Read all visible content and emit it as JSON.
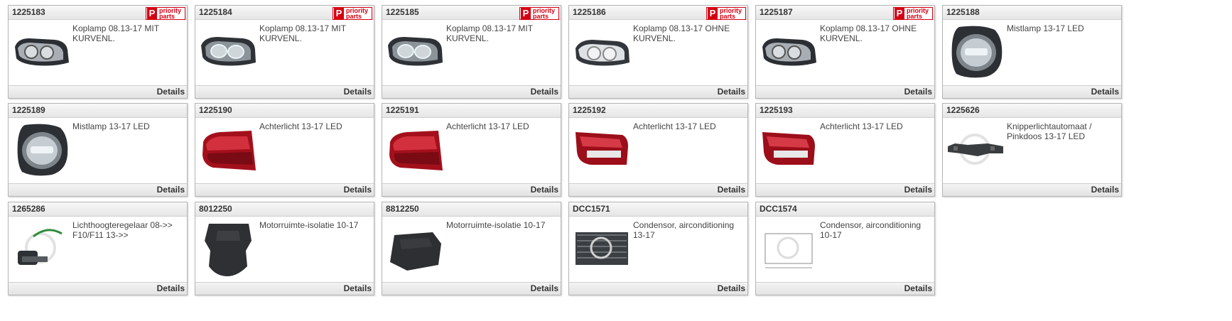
{
  "badge": {
    "letter": "P",
    "line1": "priority",
    "line2": "parts"
  },
  "products": [
    {
      "code": "1225183",
      "desc": "Koplamp 08.13-17 MIT KURVENL.",
      "details": "Details",
      "icon": "headlamp-dark",
      "priority": true
    },
    {
      "code": "1225184",
      "desc": "Koplamp 08.13-17 MIT KURVENL.",
      "details": "Details",
      "icon": "headlamp-led",
      "priority": true
    },
    {
      "code": "1225185",
      "desc": "Koplamp 08.13-17 MIT KURVENL.",
      "details": "Details",
      "icon": "headlamp-led",
      "priority": true
    },
    {
      "code": "1225186",
      "desc": "Koplamp 08.13-17 OHNE KURVENL.",
      "details": "Details",
      "icon": "headlamp-chrome",
      "priority": true
    },
    {
      "code": "1225187",
      "desc": "Koplamp 08.13-17 OHNE KURVENL.",
      "details": "Details",
      "icon": "headlamp-dark",
      "priority": true
    },
    {
      "code": "1225188",
      "desc": "Mistlamp 13-17 LED",
      "details": "Details",
      "icon": "foglamp",
      "priority": false
    },
    {
      "code": "1225189",
      "desc": "Mistlamp 13-17 LED",
      "details": "Details",
      "icon": "foglamp",
      "priority": false
    },
    {
      "code": "1225190",
      "desc": "Achterlicht 13-17 LED",
      "details": "Details",
      "icon": "taillight-outer",
      "priority": false
    },
    {
      "code": "1225191",
      "desc": "Achterlicht 13-17 LED",
      "details": "Details",
      "icon": "taillight-outer",
      "priority": false
    },
    {
      "code": "1225192",
      "desc": "Achterlicht 13-17 LED",
      "details": "Details",
      "icon": "taillight-inner",
      "priority": false
    },
    {
      "code": "1225193",
      "desc": "Achterlicht 13-17 LED",
      "details": "Details",
      "icon": "taillight-inner",
      "priority": false
    },
    {
      "code": "1225626",
      "desc": "Knipperlichtautomaat / Pinkdoos 13-17 LED",
      "details": "Details",
      "icon": "flasher-relay",
      "priority": false
    },
    {
      "code": "1265286",
      "desc": "Lichthoogteregelaar 08->> F10/F11 13->>",
      "details": "Details",
      "icon": "level-motor",
      "priority": false
    },
    {
      "code": "8012250",
      "desc": "Motorruimte-isolatie 10-17",
      "details": "Details",
      "icon": "insulation-mat",
      "priority": false
    },
    {
      "code": "8812250",
      "desc": "Motorruimte-isolatie 10-17",
      "details": "Details",
      "icon": "insulation-mat-flat",
      "priority": false
    },
    {
      "code": "DCC1571",
      "desc": "Condensor, airconditioning 13-17",
      "details": "Details",
      "icon": "condenser",
      "priority": false
    },
    {
      "code": "DCC1574",
      "desc": "Condensor, airconditioning 10-17",
      "details": "Details",
      "icon": "condenser-drawing",
      "priority": false
    }
  ]
}
